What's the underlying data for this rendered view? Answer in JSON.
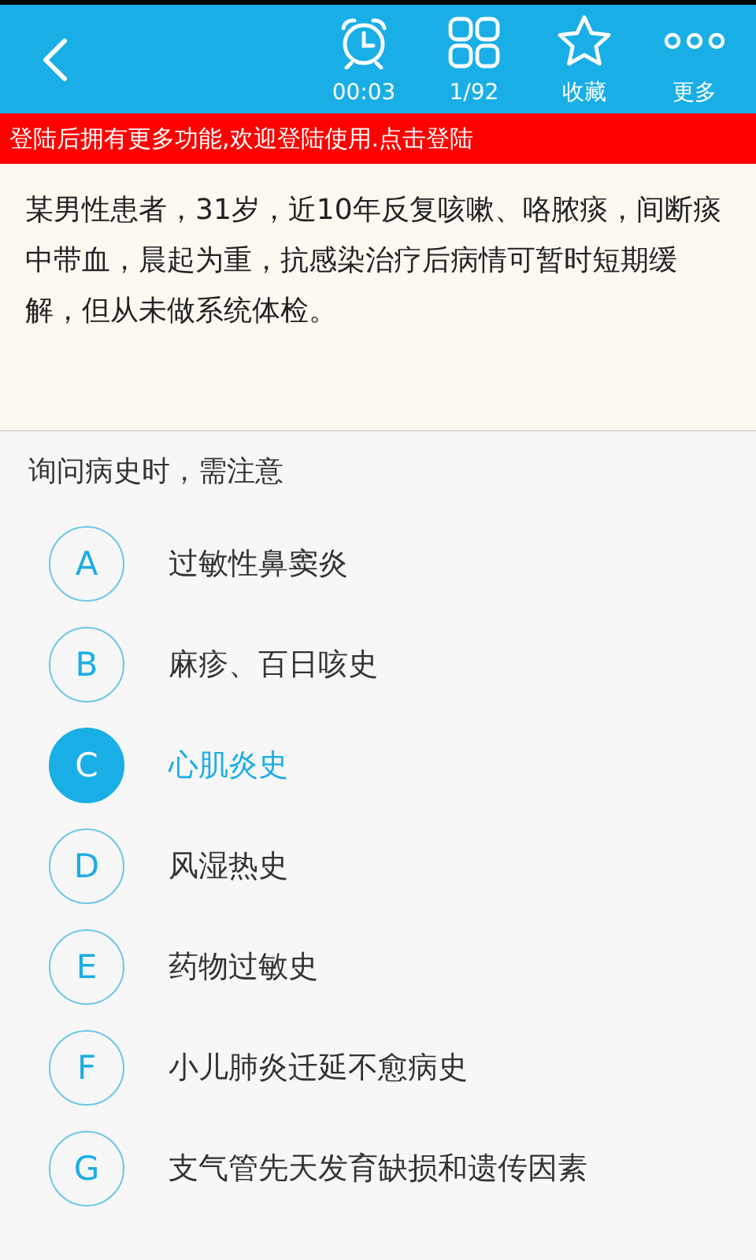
{
  "toolbar": {
    "items": [
      {
        "kind": "timer",
        "label": "00:03"
      },
      {
        "kind": "grid",
        "label": "1/92"
      },
      {
        "kind": "star",
        "label": "收藏"
      },
      {
        "kind": "more",
        "label": "更多"
      }
    ]
  },
  "login_banner": "登陆后拥有更多功能,欢迎登陆使用.点击登陆",
  "passage": "某男性患者，31岁，近10年反复咳嗽、咯脓痰，间断痰中带血，晨起为重，抗感染治疗后病情可暂时短期缓解，但从未做系统体检。",
  "question": "询问病史时，需注意",
  "options": [
    {
      "letter": "A",
      "text": "过敏性鼻窦炎",
      "selected": false
    },
    {
      "letter": "B",
      "text": "麻疹、百日咳史",
      "selected": false
    },
    {
      "letter": "C",
      "text": "心肌炎史",
      "selected": true
    },
    {
      "letter": "D",
      "text": "风湿热史",
      "selected": false
    },
    {
      "letter": "E",
      "text": "药物过敏史",
      "selected": false
    },
    {
      "letter": "F",
      "text": "小儿肺炎迁延不愈病史",
      "selected": false
    },
    {
      "letter": "G",
      "text": "支气管先天发育缺损和遗传因素",
      "selected": false
    }
  ]
}
